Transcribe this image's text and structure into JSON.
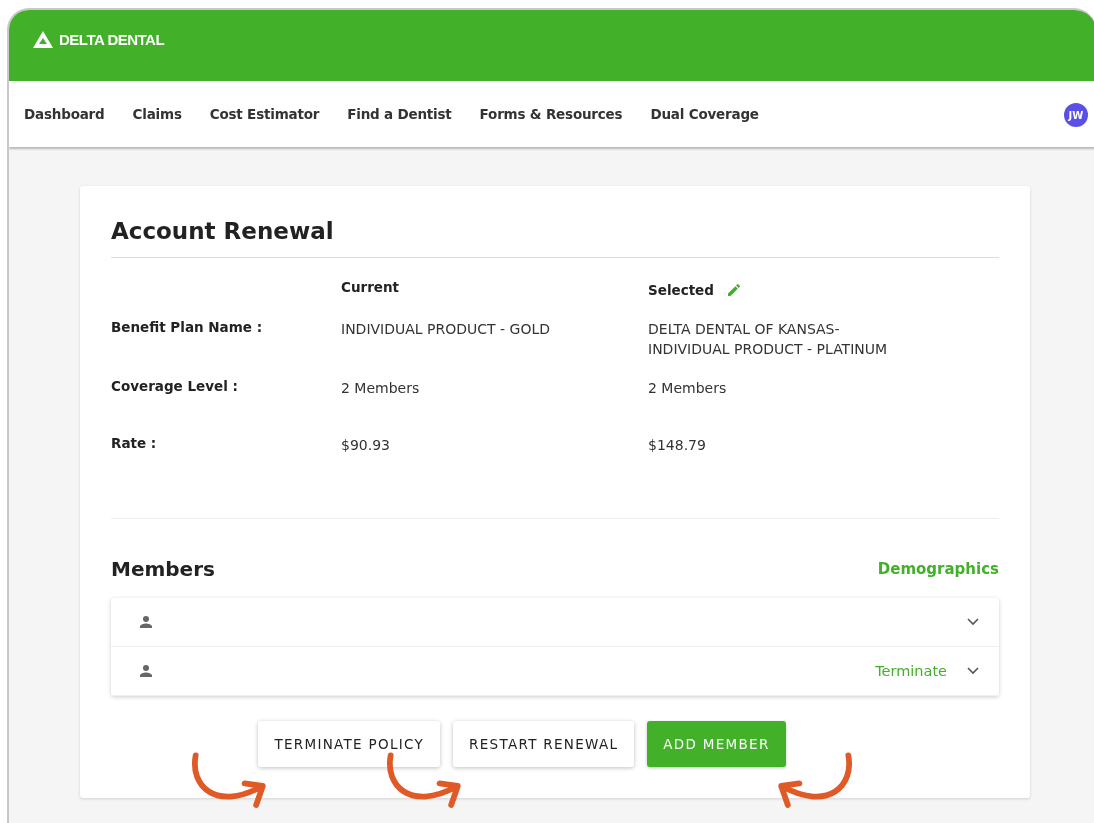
{
  "header": {
    "logo": "DELTA DENTAL"
  },
  "nav": {
    "items": [
      {
        "label": "Dashboard"
      },
      {
        "label": "Claims"
      },
      {
        "label": "Cost Estimator"
      },
      {
        "label": "Find a Dentist"
      },
      {
        "label": "Forms & Resources"
      },
      {
        "label": "Dual Coverage"
      }
    ],
    "avatar": "JW"
  },
  "renewal": {
    "title": "Account Renewal",
    "columns": [
      "Current",
      "Selected"
    ],
    "rows": [
      {
        "label": "Benefit Plan Name :",
        "current": "INDIVIDUAL PRODUCT - GOLD",
        "selected": "DELTA DENTAL OF KANSAS-\nINDIVIDUAL PRODUCT - PLATINUM"
      },
      {
        "label": "Coverage Level :",
        "current": "2 Members",
        "selected": "2 Members"
      },
      {
        "label": "Rate :",
        "current": "$90.93",
        "selected": "$148.79"
      }
    ]
  },
  "members": {
    "title": "Members",
    "link": "Demographics",
    "rows": [
      {
        "action": null
      },
      {
        "action": "Terminate"
      }
    ]
  },
  "buttons": [
    {
      "label": "TERMINATE POLICY",
      "kind": "outline",
      "arrow": true,
      "arrow_mirrored": false
    },
    {
      "label": "RESTART RENEWAL",
      "kind": "outline",
      "arrow": true,
      "arrow_mirrored": false
    },
    {
      "label": "ADD MEMBER",
      "kind": "primary",
      "arrow": true,
      "arrow_mirrored": true
    }
  ]
}
